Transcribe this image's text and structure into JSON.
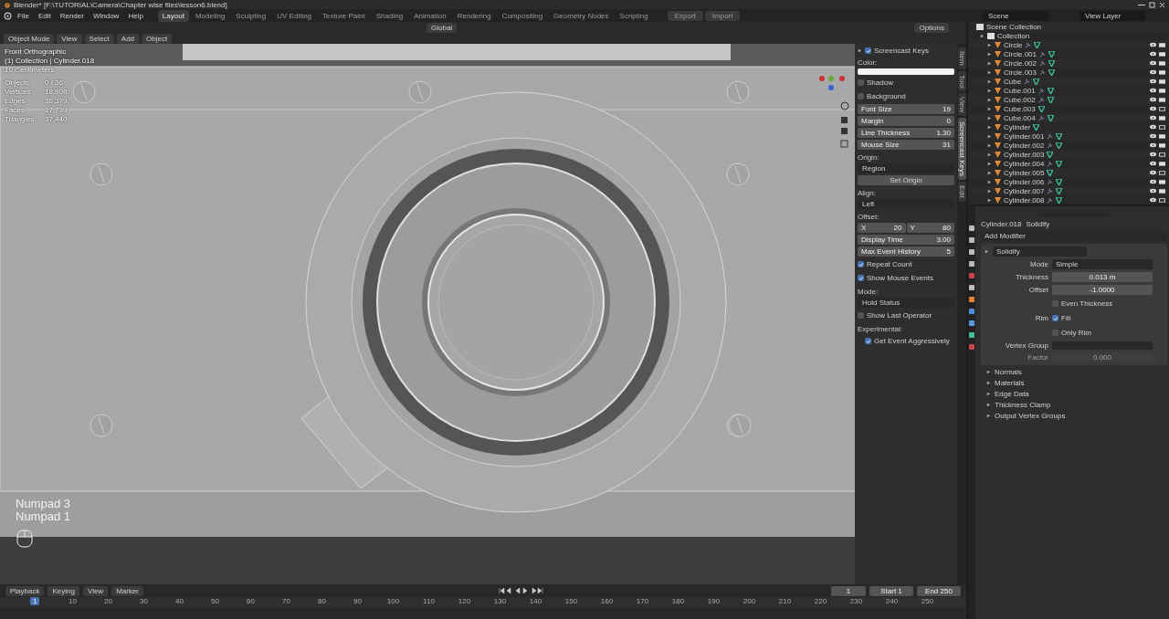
{
  "window": {
    "title": "Blender* [F:\\TUTORIAL\\Camera\\Chapter wise files\\lesson6.blend]"
  },
  "menu": [
    "File",
    "Edit",
    "Render",
    "Window",
    "Help"
  ],
  "workspaces": [
    {
      "label": "Layout",
      "selected": true
    },
    {
      "label": "Modeling",
      "selected": false
    },
    {
      "label": "Sculpting",
      "selected": false
    },
    {
      "label": "UV Editing",
      "selected": false
    },
    {
      "label": "Texture Paint",
      "selected": false
    },
    {
      "label": "Shading",
      "selected": false
    },
    {
      "label": "Animation",
      "selected": false
    },
    {
      "label": "Rendering",
      "selected": false
    },
    {
      "label": "Compositing",
      "selected": false
    },
    {
      "label": "Geometry Nodes",
      "selected": false
    },
    {
      "label": "Scripting",
      "selected": false
    }
  ],
  "header_buttons": [
    "Export",
    "Import"
  ],
  "scene": "Scene",
  "view_layer": "View Layer",
  "viewport": {
    "transform": "Global",
    "options": "Options",
    "mode": "Object Mode",
    "menus": [
      "View",
      "Select",
      "Add",
      "Object"
    ],
    "overlay": [
      "Front Orthographic",
      "(1) Collection | Cylinder.018",
      "10 Centimeters"
    ],
    "stats": [
      {
        "label": "Objects",
        "value": "0 / 36"
      },
      {
        "label": "Vertices",
        "value": "18,808"
      },
      {
        "label": "Edges",
        "value": "36,379"
      },
      {
        "label": "Faces",
        "value": "17,739"
      },
      {
        "label": "Triangles",
        "value": "37,440"
      }
    ],
    "keys": [
      "Numpad 3",
      "Numpad 1"
    ]
  },
  "npanel": {
    "tabs": [
      {
        "label": "Item",
        "selected": false
      },
      {
        "label": "Tool",
        "selected": false
      },
      {
        "label": "View",
        "selected": false
      },
      {
        "label": "Screencast Keys",
        "selected": true
      },
      {
        "label": "Edit",
        "selected": false
      }
    ],
    "title": "Screencast Keys",
    "enabled": true,
    "rows": [
      {
        "kind": "label",
        "text": "Color:"
      },
      {
        "kind": "color"
      },
      {
        "kind": "check",
        "label": "Shadow",
        "checked": false
      },
      {
        "kind": "check",
        "label": "Background",
        "checked": false
      },
      {
        "kind": "field",
        "label": "Font Size",
        "value": "19"
      },
      {
        "kind": "field",
        "label": "Margin",
        "value": "0"
      },
      {
        "kind": "field",
        "label": "Line Thickness",
        "value": "1.30"
      },
      {
        "kind": "field",
        "label": "Mouse Size",
        "value": "31"
      },
      {
        "kind": "label",
        "text": "Origin:"
      },
      {
        "kind": "dropdown",
        "value": "Region"
      },
      {
        "kind": "button",
        "label": "Set Origin"
      },
      {
        "kind": "label",
        "text": "Align:"
      },
      {
        "kind": "dropdown",
        "value": "Left"
      },
      {
        "kind": "label",
        "text": "Offset:"
      },
      {
        "kind": "xy",
        "items": [
          {
            "label": "X",
            "value": "20"
          },
          {
            "label": "Y",
            "value": "80"
          }
        ]
      },
      {
        "kind": "field",
        "label": "Display Time",
        "value": "3.00"
      },
      {
        "kind": "field",
        "label": "Max Event History",
        "value": "5"
      },
      {
        "kind": "check",
        "label": "Repeat Count",
        "checked": true
      },
      {
        "kind": "check",
        "label": "Show Mouse Events",
        "checked": true
      },
      {
        "kind": "label",
        "text": "Mode:"
      },
      {
        "kind": "dropdown",
        "value": "Hold Status"
      },
      {
        "kind": "check",
        "label": "Show Last Operator",
        "checked": false
      },
      {
        "kind": "label",
        "text": "Experimental:"
      },
      {
        "kind": "subcheck",
        "label": "Get Event Aggressively",
        "checked": true
      }
    ]
  },
  "outliner": {
    "root": "Scene Collection",
    "collection": "Collection",
    "children": [
      {
        "name": "Circle",
        "modifier": true,
        "renderable": true
      },
      {
        "name": "Circle.001",
        "modifier": true,
        "renderable": true
      },
      {
        "name": "Circle.002",
        "modifier": true,
        "renderable": true
      },
      {
        "name": "Circle.003",
        "modifier": true,
        "renderable": true
      },
      {
        "name": "Cube",
        "modifier": true,
        "renderable": true
      },
      {
        "name": "Cube.001",
        "modifier": true,
        "renderable": true
      },
      {
        "name": "Cube.002",
        "modifier": true,
        "renderable": true
      },
      {
        "name": "Cube.003",
        "modifier": false,
        "renderable": false
      },
      {
        "name": "Cube.004",
        "modifier": true,
        "renderable": true
      },
      {
        "name": "Cylinder",
        "modifier": false,
        "renderable": false
      },
      {
        "name": "Cylinder.001",
        "modifier": true,
        "renderable": true
      },
      {
        "name": "Cylinder.002",
        "modifier": true,
        "renderable": true
      },
      {
        "name": "Cylinder.003",
        "modifier": false,
        "renderable": false
      },
      {
        "name": "Cylinder.004",
        "modifier": true,
        "renderable": true
      },
      {
        "name": "Cylinder.005",
        "modifier": false,
        "renderable": false
      },
      {
        "name": "Cylinder.006",
        "modifier": true,
        "renderable": true
      },
      {
        "name": "Cylinder.007",
        "modifier": true,
        "renderable": true
      },
      {
        "name": "Cylinder.008",
        "modifier": true,
        "renderable": false
      }
    ]
  },
  "properties": {
    "object": "Cylinder.018",
    "modifier": "Solidify",
    "add_modifier": "Add Modifier",
    "panel_name": "Solidify",
    "rows": [
      {
        "kind": "dropdown",
        "label": "Mode",
        "value": "Simple",
        "disabled": false
      },
      {
        "kind": "field",
        "label": "Thickness",
        "value": "0.013 m",
        "disabled": false
      },
      {
        "kind": "field",
        "label": "Offset",
        "value": "-1.0000",
        "disabled": false
      },
      {
        "kind": "check",
        "label": "Even Thickness",
        "checked": false,
        "disabled": false
      },
      {
        "kind": "check",
        "side_label": "Rim",
        "label": "Fill",
        "checked": true,
        "disabled": false
      },
      {
        "kind": "check",
        "label": "Only Rim",
        "checked": false,
        "disabled": false
      },
      {
        "kind": "group",
        "label": "Vertex Group",
        "disabled": false
      },
      {
        "kind": "field",
        "label": "Factor",
        "value": "0.000",
        "disabled": true
      }
    ],
    "subpanels": [
      "Normals",
      "Materials",
      "Edge Data",
      "Thickness Clamp",
      "Output Vertex Groups"
    ]
  },
  "timeline": {
    "menus": [
      "Playback",
      "Keying",
      "View",
      "Marker"
    ],
    "current_frame": "1",
    "frame_field": "1",
    "start_label": "Start",
    "start": "1",
    "end_label": "End",
    "end": "250",
    "ticks": [
      "10",
      "20",
      "30",
      "40",
      "50",
      "60",
      "70",
      "80",
      "90",
      "100",
      "110",
      "120",
      "130",
      "140",
      "150",
      "160",
      "170",
      "180",
      "190",
      "200",
      "210",
      "220",
      "230",
      "240",
      "250"
    ]
  }
}
